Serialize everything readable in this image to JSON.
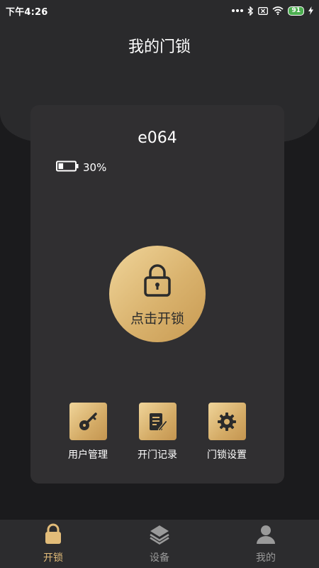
{
  "status_bar": {
    "time": "下午4:26",
    "battery": "91"
  },
  "header": {
    "title": "我的门锁"
  },
  "device": {
    "name": "e064",
    "battery_percent": "30%",
    "battery_level": 0.3
  },
  "unlock": {
    "label": "点击开锁"
  },
  "actions": [
    {
      "label": "用户管理",
      "icon": "key-icon"
    },
    {
      "label": "开门记录",
      "icon": "document-edit-icon"
    },
    {
      "label": "门锁设置",
      "icon": "gear-icon"
    }
  ],
  "tabs": [
    {
      "label": "开锁",
      "icon": "lock-icon",
      "active": true
    },
    {
      "label": "设备",
      "icon": "layers-icon",
      "active": false
    },
    {
      "label": "我的",
      "icon": "user-icon",
      "active": false
    }
  ],
  "colors": {
    "accent": "#e2bc79",
    "background": "#1b1b1d",
    "card": "#302f31"
  }
}
